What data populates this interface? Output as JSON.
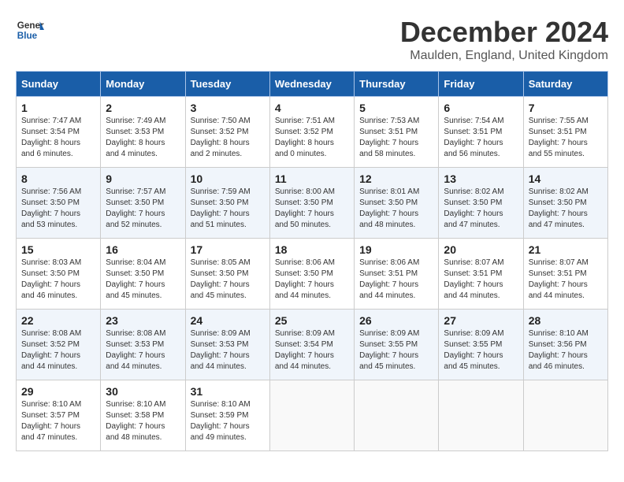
{
  "logo": {
    "line1": "General",
    "line2": "Blue"
  },
  "title": "December 2024",
  "subtitle": "Maulden, England, United Kingdom",
  "days_of_week": [
    "Sunday",
    "Monday",
    "Tuesday",
    "Wednesday",
    "Thursday",
    "Friday",
    "Saturday"
  ],
  "weeks": [
    [
      {
        "day": "1",
        "sunrise": "7:47 AM",
        "sunset": "3:54 PM",
        "daylight": "8 hours and 6 minutes."
      },
      {
        "day": "2",
        "sunrise": "7:49 AM",
        "sunset": "3:53 PM",
        "daylight": "8 hours and 4 minutes."
      },
      {
        "day": "3",
        "sunrise": "7:50 AM",
        "sunset": "3:52 PM",
        "daylight": "8 hours and 2 minutes."
      },
      {
        "day": "4",
        "sunrise": "7:51 AM",
        "sunset": "3:52 PM",
        "daylight": "8 hours and 0 minutes."
      },
      {
        "day": "5",
        "sunrise": "7:53 AM",
        "sunset": "3:51 PM",
        "daylight": "7 hours and 58 minutes."
      },
      {
        "day": "6",
        "sunrise": "7:54 AM",
        "sunset": "3:51 PM",
        "daylight": "7 hours and 56 minutes."
      },
      {
        "day": "7",
        "sunrise": "7:55 AM",
        "sunset": "3:51 PM",
        "daylight": "7 hours and 55 minutes."
      }
    ],
    [
      {
        "day": "8",
        "sunrise": "7:56 AM",
        "sunset": "3:50 PM",
        "daylight": "7 hours and 53 minutes."
      },
      {
        "day": "9",
        "sunrise": "7:57 AM",
        "sunset": "3:50 PM",
        "daylight": "7 hours and 52 minutes."
      },
      {
        "day": "10",
        "sunrise": "7:59 AM",
        "sunset": "3:50 PM",
        "daylight": "7 hours and 51 minutes."
      },
      {
        "day": "11",
        "sunrise": "8:00 AM",
        "sunset": "3:50 PM",
        "daylight": "7 hours and 50 minutes."
      },
      {
        "day": "12",
        "sunrise": "8:01 AM",
        "sunset": "3:50 PM",
        "daylight": "7 hours and 48 minutes."
      },
      {
        "day": "13",
        "sunrise": "8:02 AM",
        "sunset": "3:50 PM",
        "daylight": "7 hours and 47 minutes."
      },
      {
        "day": "14",
        "sunrise": "8:02 AM",
        "sunset": "3:50 PM",
        "daylight": "7 hours and 47 minutes."
      }
    ],
    [
      {
        "day": "15",
        "sunrise": "8:03 AM",
        "sunset": "3:50 PM",
        "daylight": "7 hours and 46 minutes."
      },
      {
        "day": "16",
        "sunrise": "8:04 AM",
        "sunset": "3:50 PM",
        "daylight": "7 hours and 45 minutes."
      },
      {
        "day": "17",
        "sunrise": "8:05 AM",
        "sunset": "3:50 PM",
        "daylight": "7 hours and 45 minutes."
      },
      {
        "day": "18",
        "sunrise": "8:06 AM",
        "sunset": "3:50 PM",
        "daylight": "7 hours and 44 minutes."
      },
      {
        "day": "19",
        "sunrise": "8:06 AM",
        "sunset": "3:51 PM",
        "daylight": "7 hours and 44 minutes."
      },
      {
        "day": "20",
        "sunrise": "8:07 AM",
        "sunset": "3:51 PM",
        "daylight": "7 hours and 44 minutes."
      },
      {
        "day": "21",
        "sunrise": "8:07 AM",
        "sunset": "3:51 PM",
        "daylight": "7 hours and 44 minutes."
      }
    ],
    [
      {
        "day": "22",
        "sunrise": "8:08 AM",
        "sunset": "3:52 PM",
        "daylight": "7 hours and 44 minutes."
      },
      {
        "day": "23",
        "sunrise": "8:08 AM",
        "sunset": "3:53 PM",
        "daylight": "7 hours and 44 minutes."
      },
      {
        "day": "24",
        "sunrise": "8:09 AM",
        "sunset": "3:53 PM",
        "daylight": "7 hours and 44 minutes."
      },
      {
        "day": "25",
        "sunrise": "8:09 AM",
        "sunset": "3:54 PM",
        "daylight": "7 hours and 44 minutes."
      },
      {
        "day": "26",
        "sunrise": "8:09 AM",
        "sunset": "3:55 PM",
        "daylight": "7 hours and 45 minutes."
      },
      {
        "day": "27",
        "sunrise": "8:09 AM",
        "sunset": "3:55 PM",
        "daylight": "7 hours and 45 minutes."
      },
      {
        "day": "28",
        "sunrise": "8:10 AM",
        "sunset": "3:56 PM",
        "daylight": "7 hours and 46 minutes."
      }
    ],
    [
      {
        "day": "29",
        "sunrise": "8:10 AM",
        "sunset": "3:57 PM",
        "daylight": "7 hours and 47 minutes."
      },
      {
        "day": "30",
        "sunrise": "8:10 AM",
        "sunset": "3:58 PM",
        "daylight": "7 hours and 48 minutes."
      },
      {
        "day": "31",
        "sunrise": "8:10 AM",
        "sunset": "3:59 PM",
        "daylight": "7 hours and 49 minutes."
      },
      null,
      null,
      null,
      null
    ]
  ],
  "labels": {
    "sunrise": "Sunrise:",
    "sunset": "Sunset:",
    "daylight": "Daylight:"
  }
}
